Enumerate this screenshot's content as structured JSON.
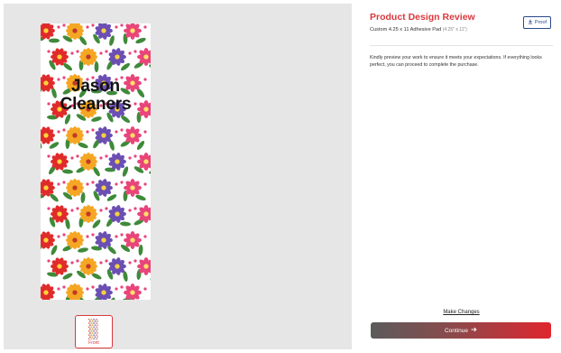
{
  "preview": {
    "design_text_line1": "Jason",
    "design_text_line2": "Cleaners",
    "thumbnail_label": "Front"
  },
  "review": {
    "title": "Product Design Review",
    "product_name": "Custom 4.25 x 11 Adhesive Pad",
    "product_dims": "(4.25\" x 11\")",
    "proof_label": "Proof",
    "proof_icon": "download-icon",
    "note": "Kindly preview your work to ensure it meets your expectations. If everything looks perfect, you can proceed to complete the purchase.",
    "make_changes_label": "Make Changes",
    "continue_label": "Continue",
    "continue_icon": "arrow-right-icon"
  },
  "colors": {
    "accent": "#d9393e",
    "preview_bg": "#e6e6e6",
    "proof_blue": "#2a4a8a"
  }
}
